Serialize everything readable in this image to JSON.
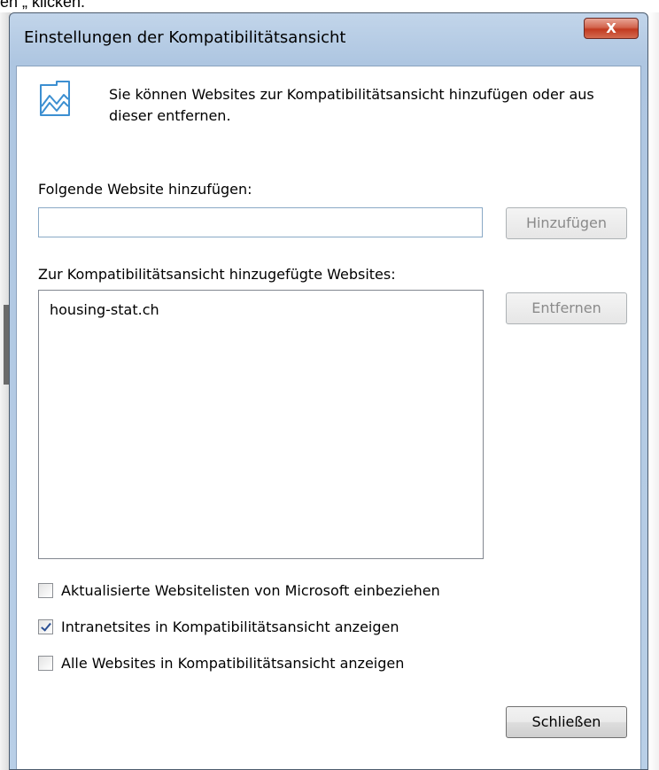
{
  "background_caption": "en „ klicken.",
  "dialog": {
    "title": "Einstellungen der Kompatibilitätsansicht",
    "close_label": "X",
    "info_text": "Sie können Websites zur Kompatibilitätsansicht hinzufügen oder aus dieser entfernen.",
    "info_icon": "compatibility-view-icon",
    "add_label": "Folgende Website hinzufügen:",
    "add_input_value": "",
    "add_button": "Hinzufügen",
    "list_label": "Zur Kompatibilitätsansicht hinzugefügte Websites:",
    "sites": [
      "housing-stat.ch"
    ],
    "remove_button": "Entfernen",
    "checkboxes": [
      {
        "label": "Aktualisierte Websitelisten von Microsoft einbeziehen",
        "checked": false
      },
      {
        "label": "Intranetsites in Kompatibilitätsansicht anzeigen",
        "checked": true
      },
      {
        "label": "Alle Websites in Kompatibilitätsansicht anzeigen",
        "checked": false
      }
    ],
    "close_button": "Schließen"
  },
  "colors": {
    "titlebar": "#aec6e1",
    "close_button": "#c23a20",
    "checkmark": "#2b4f93"
  }
}
